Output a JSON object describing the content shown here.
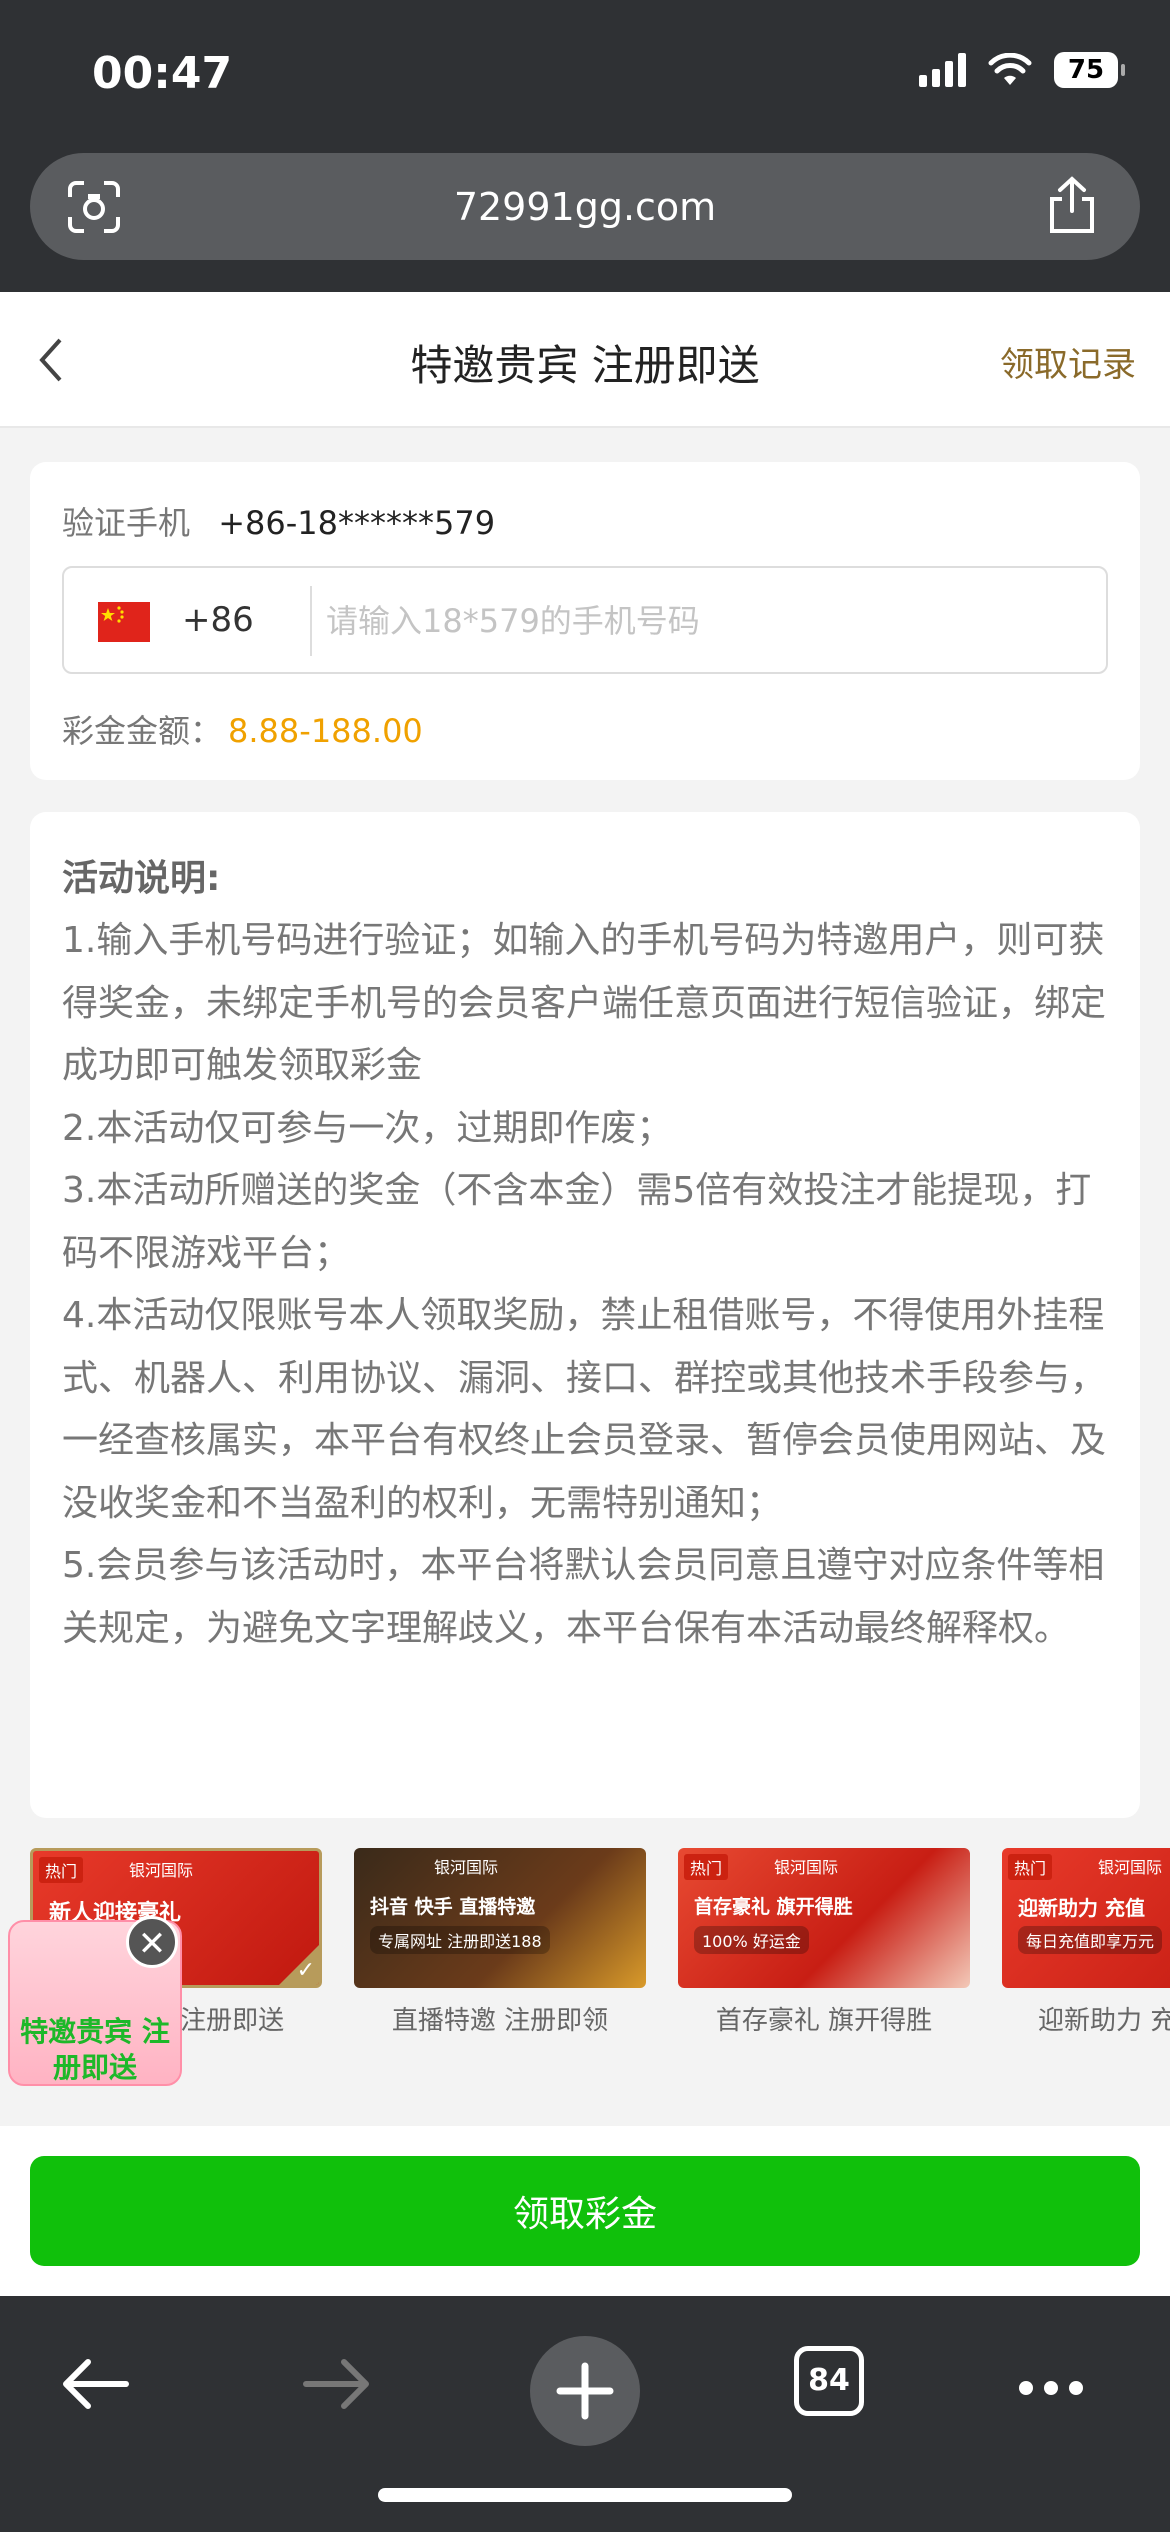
{
  "status_bar": {
    "time": "00:47",
    "battery": "75"
  },
  "browser": {
    "url": "72991gg.com",
    "tab_count": "84"
  },
  "header": {
    "title": "特邀贵宾 注册即送",
    "record_link": "领取记录"
  },
  "verify": {
    "label": "验证手机",
    "phone_masked": "+86-18******579",
    "country_code": "+86",
    "placeholder": "请输入18*579的手机号码",
    "value": ""
  },
  "bonus": {
    "label": "彩金金额：",
    "range": "8.88-188.00"
  },
  "description": {
    "title": "活动说明:",
    "items": [
      "1.输入手机号码进行验证；如输入的手机号码为特邀用户，则可获得奖金，未绑定手机号的会员客户端任意页面进行短信验证，绑定成功即可触发领取彩金",
      "2.本活动仅可参与一次，过期即作废；",
      "3.本活动所赠送的奖金（不含本金）需5倍有效投注才能提现，打码不限游戏平台；",
      "4.本活动仅限账号本人领取奖励，禁止租借账号，不得使用外挂程式、机器人、利用协议、漏洞、接口、群控或其他技术手段参与，一经查核属实，本平台有权终止会员登录、暂停会员使用网站、及没收奖金和不当盈利的权利，无需特别通知；",
      "5.会员参与该活动时，本平台将默认会员同意且遵守对应条件等相关规定，为避免文字理解歧义，本平台保有本活动最终解释权。"
    ]
  },
  "promos": [
    {
      "caption": "特邀贵宾 注册即送",
      "banner_head": "新人迎接豪礼",
      "banner_sub": "",
      "hot": "热门",
      "brand": "银河国际",
      "color": "#d6261f"
    },
    {
      "caption": "直播特邀 注册即领",
      "banner_head": "抖音 快手 直播特邀",
      "banner_sub": "专属网址 注册即送188",
      "hot": "",
      "brand": "银河国际",
      "color": "#3a2a1a"
    },
    {
      "caption": "首存豪礼 旗开得胜",
      "banner_head": "首存豪礼 旗开得胜",
      "banner_sub": "100% 好运金",
      "hot": "热门",
      "brand": "银河国际",
      "color": "#e03a2a"
    },
    {
      "caption": "迎新助力 充值",
      "banner_head": "迎新助力 充值",
      "banner_sub": "每日充值即享万元",
      "hot": "热门",
      "brand": "银河国际",
      "color": "#d6261f"
    }
  ],
  "float_promo": {
    "text": "特邀贵宾 注册即送",
    "close": "✕"
  },
  "claim_button": "领取彩金"
}
